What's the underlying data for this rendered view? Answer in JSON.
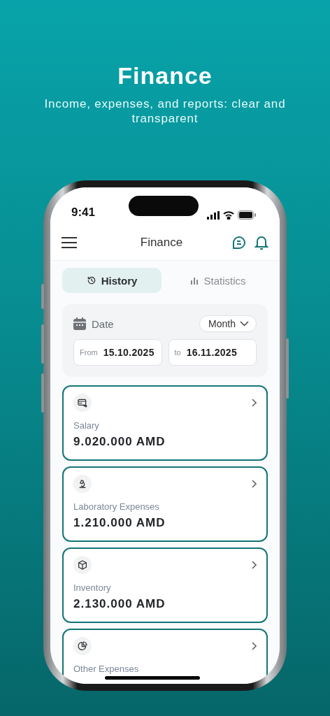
{
  "header": {
    "title": "Finance",
    "subtitle": "Income, expenses, and reports: clear and transparent"
  },
  "status_bar": {
    "time": "9:41"
  },
  "app_bar": {
    "title": "Finance"
  },
  "tabs": [
    {
      "kind": "history",
      "label": "History",
      "selected": true
    },
    {
      "kind": "chart",
      "label": "Statistics",
      "selected": false
    }
  ],
  "date_filter": {
    "label": "Date",
    "period": "Month",
    "from": {
      "label": "From",
      "value": "15.10.2025"
    },
    "to": {
      "label": "to",
      "value": "16.11.2025"
    }
  },
  "categories": [
    {
      "kind": "card",
      "label": "Salary",
      "amount": "9.020.000 AMD"
    },
    {
      "kind": "lab",
      "label": "Laboratory Expenses",
      "amount": "1.210.000 AMD"
    },
    {
      "kind": "box",
      "label": "Inventory",
      "amount": "2.130.000 AMD"
    },
    {
      "kind": "pie",
      "label": "Other Expenses"
    }
  ]
}
